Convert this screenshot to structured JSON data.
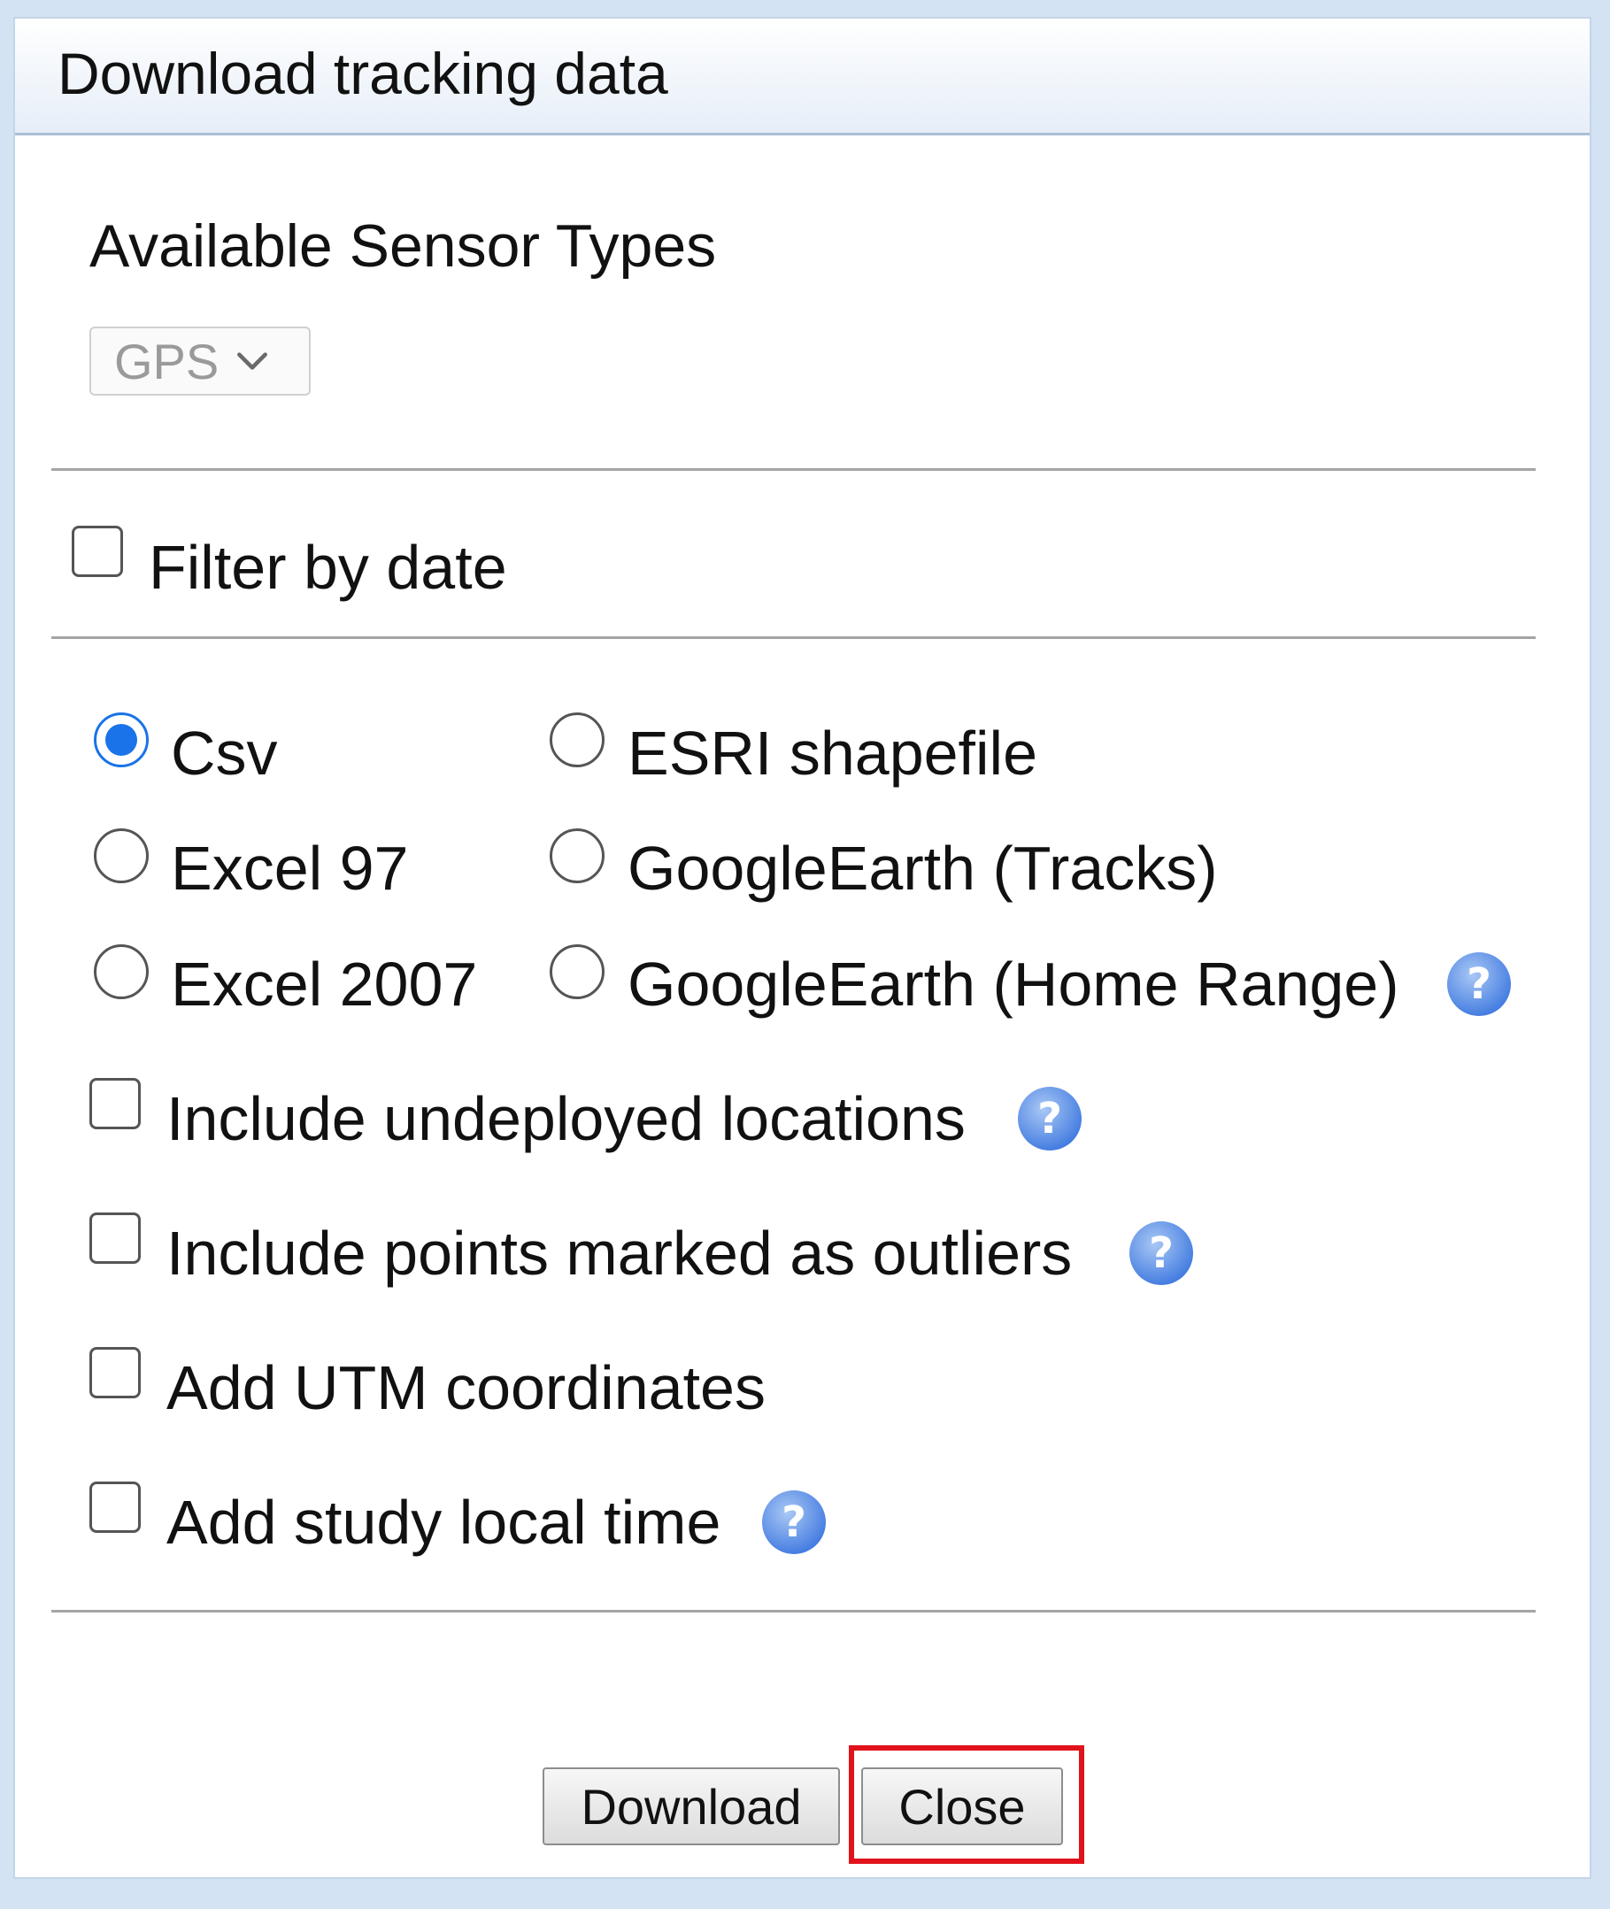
{
  "dialog": {
    "title": "Download tracking data"
  },
  "sensor": {
    "heading": "Available Sensor Types",
    "selected": "GPS"
  },
  "filter": {
    "label": "Filter by date",
    "checked": false
  },
  "formats": [
    {
      "label": "Csv",
      "checked": true
    },
    {
      "label": "ESRI shapefile",
      "checked": false
    },
    {
      "label": "Excel 97",
      "checked": false
    },
    {
      "label": "GoogleEarth (Tracks)",
      "checked": false
    },
    {
      "label": "Excel 2007",
      "checked": false
    },
    {
      "label": "GoogleEarth (Home Range)",
      "checked": false
    }
  ],
  "options": [
    {
      "label": "Include undeployed locations",
      "checked": false,
      "help": true
    },
    {
      "label": "Include points marked as outliers",
      "checked": false,
      "help": true
    },
    {
      "label": "Add UTM coordinates",
      "checked": false,
      "help": false
    },
    {
      "label": "Add study local time",
      "checked": false,
      "help": true
    }
  ],
  "buttons": {
    "download": "Download",
    "close": "Close"
  },
  "colors": {
    "accent": "#1a73e8",
    "highlight": "#e0121b",
    "help_icon": "#5b8fe6"
  },
  "icons": {
    "help": "help-icon",
    "dropdown": "chevron-down-icon"
  }
}
